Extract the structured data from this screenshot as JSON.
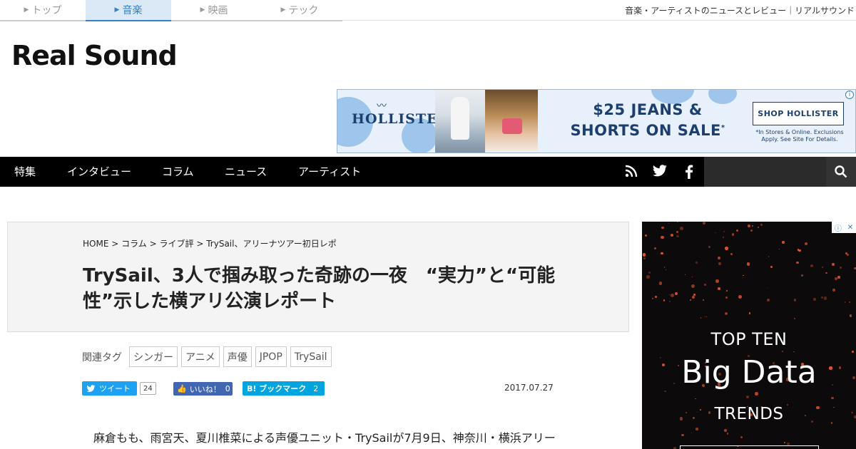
{
  "site_tabs": [
    {
      "label": "トップ",
      "active": false
    },
    {
      "label": "音楽",
      "active": true
    },
    {
      "label": "映画",
      "active": false
    },
    {
      "label": "テック",
      "active": false
    }
  ],
  "tagline": "音楽・アーティストのニュースとレビュー｜リアルサウンド",
  "logo": "Real Sound",
  "top_ad": {
    "brand": "HOLLISTER",
    "headline_line1": "$25 JEANS &",
    "headline_line2": "SHORTS ON SALE",
    "headline_mark": "*",
    "cta": "SHOP HOLLISTER",
    "fine_print": "*In Stores & Online. Exclusions Apply. See Site For Details.",
    "info": "i"
  },
  "nav": {
    "items": [
      "特集",
      "インタビュー",
      "コラム",
      "ニュース",
      "アーティスト"
    ],
    "icons": [
      "rss-icon",
      "twitter-icon",
      "facebook-icon"
    ],
    "search_placeholder": ""
  },
  "article": {
    "breadcrumb": [
      "HOME",
      "コラム",
      "ライブ評",
      "TrySail、アリーナツアー初日レポ"
    ],
    "breadcrumb_sep": ">",
    "title": "TrySail、3人で掴み取った奇跡の一夜　“実力”と“可能性”示した横アリ公演レポート",
    "tags_label": "関連タグ",
    "tags": [
      "シンガー",
      "アニメ",
      "声優",
      "JPOP",
      "TrySail"
    ],
    "share": {
      "tweet_label": "ツイート",
      "tweet_count": "24",
      "like_label": "いいね！",
      "like_count": "0",
      "bookmark_label": "B! ブックマーク",
      "bookmark_count": "2"
    },
    "date": "2017.07.27",
    "body_first_line": "麻倉もも、雨宮天、夏川椎菜による声優ユニット・TrySailが7月9日、神奈川・横浜アリー"
  },
  "side_ad": {
    "line1": "TOP TEN",
    "line2": "Big Data",
    "line3": "TRENDS",
    "adchoice_info": "ⓘ",
    "adchoice_close": "✕"
  },
  "colors": {
    "accent": "#3a7fc1",
    "nav_bg": "#000000",
    "twitter": "#1da1f2",
    "facebook": "#4267b2",
    "hatena": "#00a4de",
    "ad_dot": "#e2562c"
  }
}
